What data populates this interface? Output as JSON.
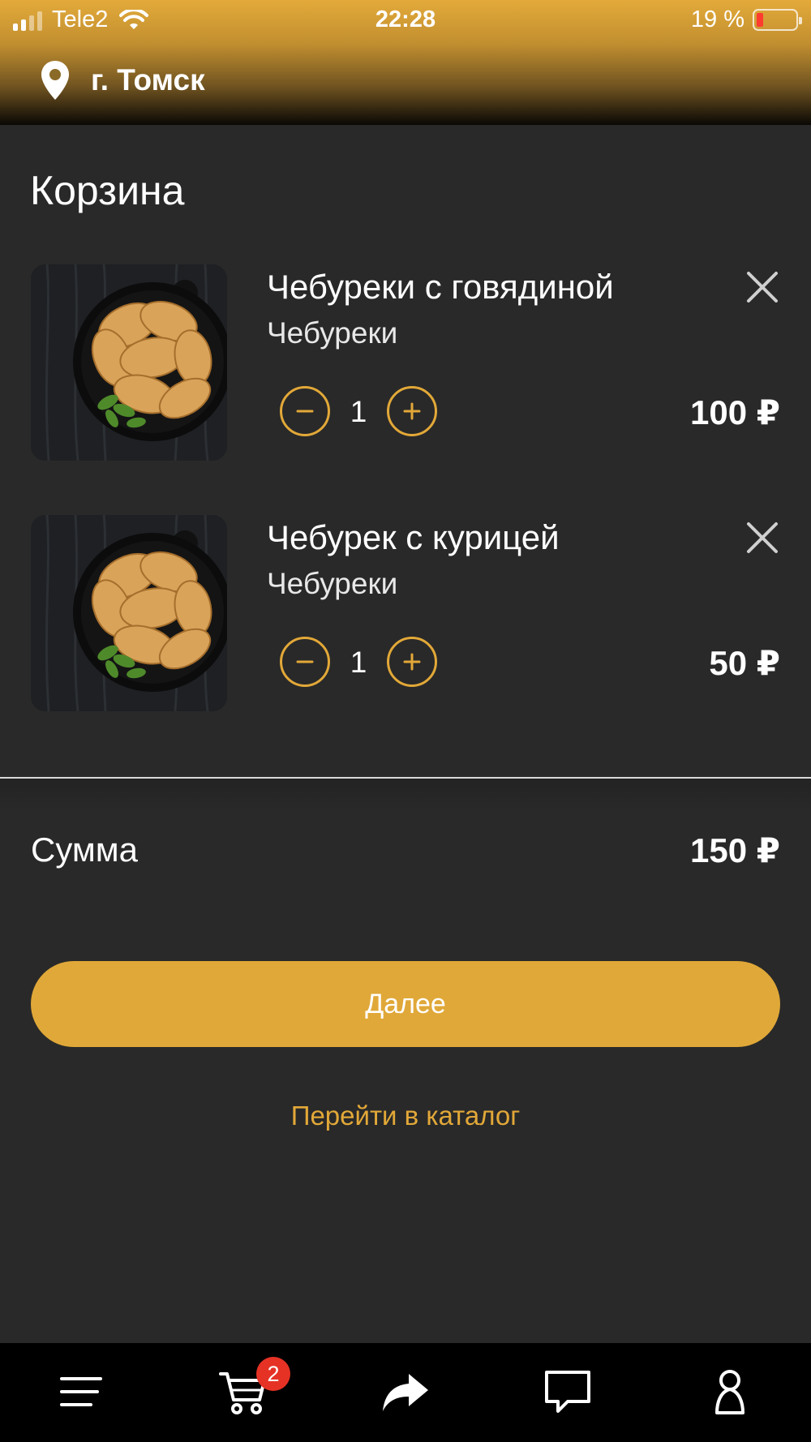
{
  "status_bar": {
    "carrier": "Tele2",
    "time": "22:28",
    "battery": "19 %"
  },
  "header": {
    "city": "г. Томск",
    "location_icon": "location-pin-icon"
  },
  "page": {
    "title": "Корзина"
  },
  "cart": {
    "items": [
      {
        "name": "Чебуреки с говядиной",
        "category": "Чебуреки",
        "quantity": "1",
        "price": "100 ₽"
      },
      {
        "name": "Чебурек с курицей",
        "category": "Чебуреки",
        "quantity": "1",
        "price": "50 ₽"
      }
    ]
  },
  "summary": {
    "label": "Сумма",
    "value": "150 ₽"
  },
  "actions": {
    "next_label": "Далее",
    "catalog_label": "Перейти в каталог"
  },
  "tabbar": {
    "cart_badge": "2",
    "icons": [
      "menu-icon",
      "cart-icon",
      "share-icon",
      "chat-icon",
      "profile-icon"
    ]
  },
  "colors": {
    "accent": "#e0a838",
    "background": "#292929",
    "tabbar": "#000000",
    "badge": "#e53225"
  }
}
